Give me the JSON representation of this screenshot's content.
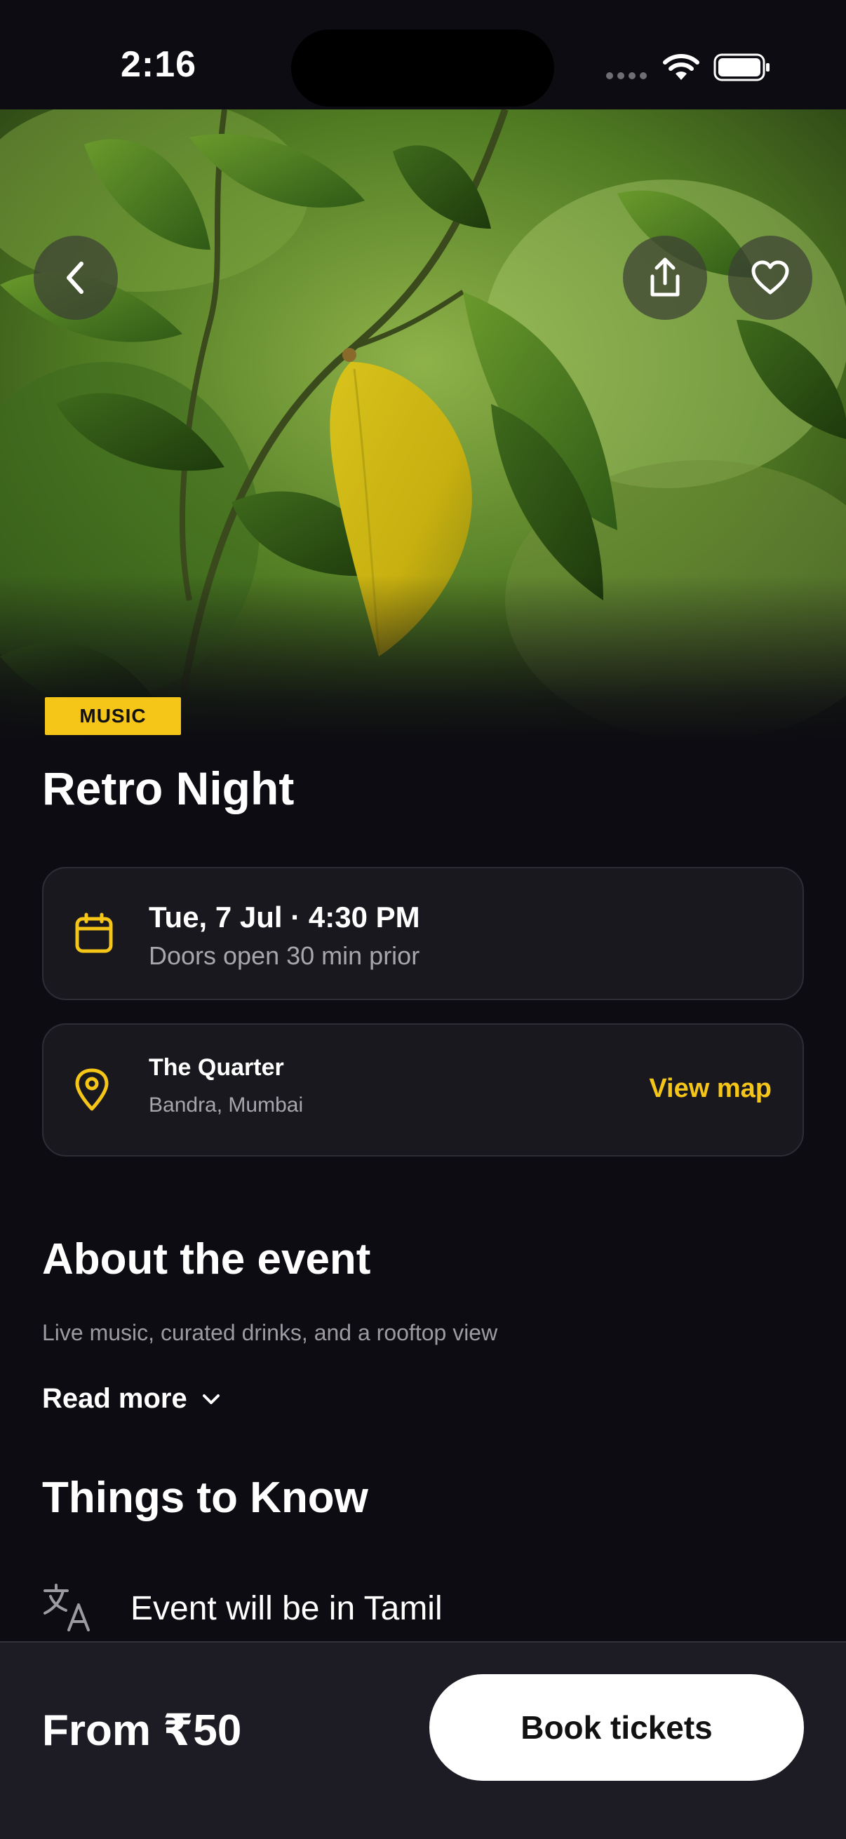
{
  "status_bar": {
    "time": "2:16"
  },
  "hero": {
    "image_subject": "green leaves with a yellow leaf",
    "back_icon": "chevron-left-icon",
    "share_icon": "share-icon",
    "favorite_icon": "heart-icon"
  },
  "event": {
    "category": "MUSIC",
    "title": "Retro Night",
    "date_line": "Tue, 7 Jul · 4:30 PM",
    "doors_note": "Doors open 30 min prior",
    "venue_name": "The Quarter",
    "venue_area": "Bandra, Mumbai",
    "view_map_label": "View map"
  },
  "about": {
    "heading": "About the event",
    "summary": "Live music, curated drinks, and a rooftop view",
    "read_more_label": "Read more"
  },
  "things_to_know": {
    "heading": "Things to Know",
    "items": [
      {
        "icon": "translate-icon",
        "text": "Event will be in Tamil"
      }
    ]
  },
  "footer": {
    "price_label": "From ₹50",
    "cta_label": "Book tickets"
  },
  "colors": {
    "background": "#0d0c12",
    "accent": "#f5c518",
    "card": "#19181e",
    "footer": "#1d1c24"
  }
}
